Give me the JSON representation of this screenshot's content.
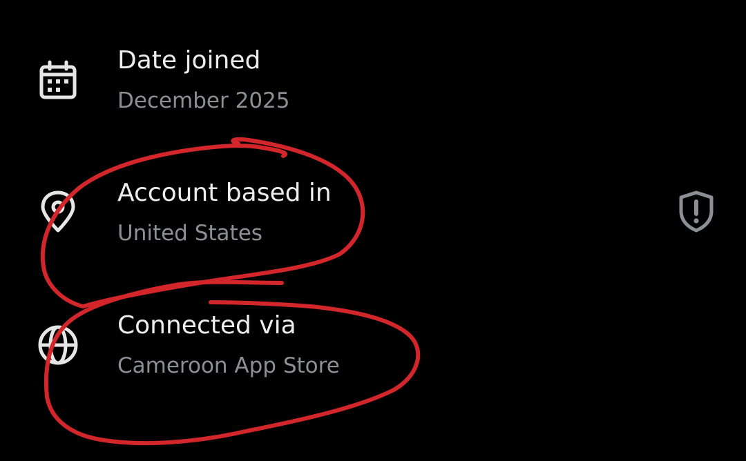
{
  "about_items": [
    {
      "title": "Date joined",
      "value": "December 2025",
      "icon": "calendar-icon"
    },
    {
      "title": "Account based in",
      "value": "United States",
      "icon": "location-pin-icon",
      "trailing_icon": "shield-alert-icon"
    },
    {
      "title": "Connected via",
      "value": "Cameroon App Store",
      "icon": "globe-icon"
    }
  ],
  "colors": {
    "background": "#000000",
    "title_text": "#ededed",
    "value_text": "#8a9096",
    "icon": "#e6e6e6",
    "trailing_icon": "#8a9096",
    "annotation_scribble": "#d3262b"
  }
}
